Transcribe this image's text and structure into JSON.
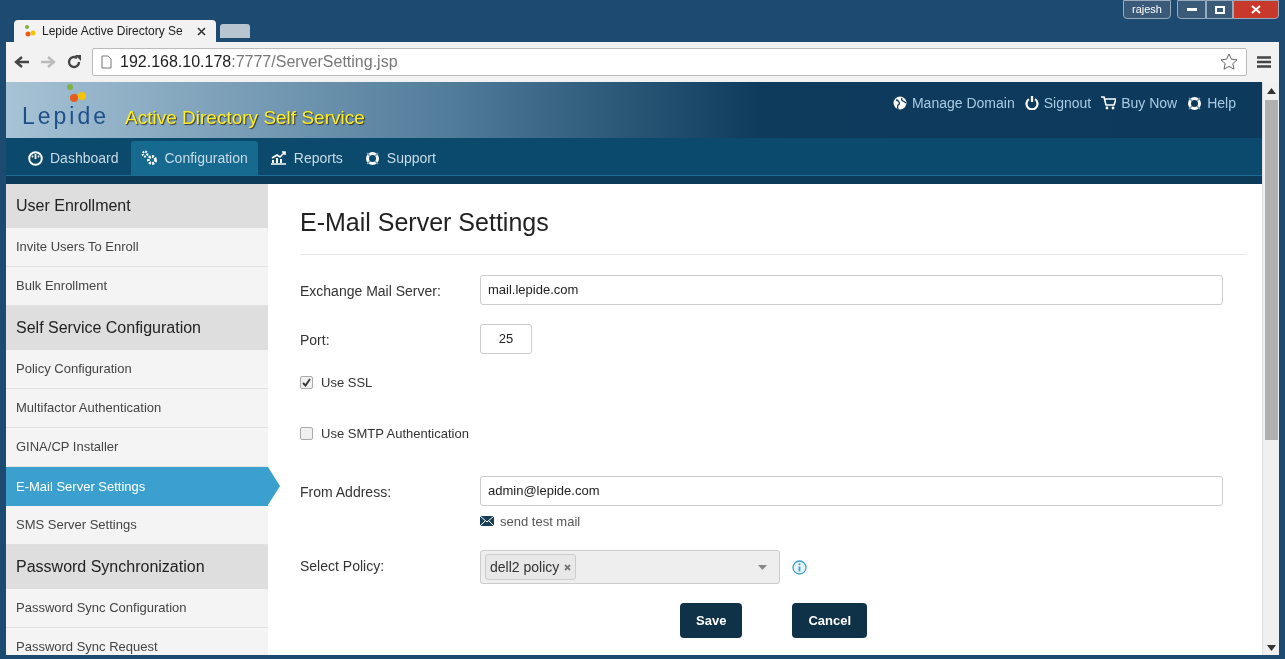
{
  "browser": {
    "tab_title": "Lepide Active Directory Se",
    "user": "rajesh",
    "url_host": "192.168.10.178",
    "url_path": ":7777/ServerSetting.jsp"
  },
  "header": {
    "logo": "Lepide",
    "product": "Active Directory Self Service",
    "links": [
      "Manage Domain",
      "Signout",
      "Buy Now",
      "Help"
    ]
  },
  "nav": [
    {
      "label": "Dashboard",
      "selected": false
    },
    {
      "label": "Configuration",
      "selected": true
    },
    {
      "label": "Reports",
      "selected": false
    },
    {
      "label": "Support",
      "selected": false
    }
  ],
  "sidebar": [
    {
      "kind": "header",
      "label": "User Enrollment"
    },
    {
      "kind": "item",
      "label": "Invite Users To Enroll",
      "selected": false
    },
    {
      "kind": "item",
      "label": "Bulk Enrollment",
      "selected": false
    },
    {
      "kind": "header",
      "label": "Self Service Configuration"
    },
    {
      "kind": "item",
      "label": "Policy Configuration",
      "selected": false
    },
    {
      "kind": "item",
      "label": "Multifactor Authentication",
      "selected": false
    },
    {
      "kind": "item",
      "label": "GINA/CP Installer",
      "selected": false
    },
    {
      "kind": "item",
      "label": "E-Mail Server Settings",
      "selected": true
    },
    {
      "kind": "item",
      "label": "SMS Server Settings",
      "selected": false
    },
    {
      "kind": "header",
      "label": "Password Synchronization"
    },
    {
      "kind": "item",
      "label": "Password Sync Configuration",
      "selected": false
    },
    {
      "kind": "item",
      "label": "Password Sync Request",
      "selected": false
    }
  ],
  "page": {
    "title": "E-Mail Server Settings",
    "fields": [
      {
        "kind": "text",
        "label": "Exchange Mail Server:",
        "value": "mail.lepide.com"
      },
      {
        "kind": "short",
        "label": "Port:",
        "value": "25"
      },
      {
        "kind": "checkbox",
        "label": "Use SSL",
        "checked": true
      },
      {
        "kind": "checkbox",
        "label": "Use SMTP Authentication",
        "checked": false
      },
      {
        "kind": "text",
        "label": "From Address:",
        "value": "admin@lepide.com",
        "link": "send test mail"
      },
      {
        "kind": "select",
        "label": "Select Policy:",
        "tags": [
          "dell2 policy"
        ]
      }
    ],
    "buttons": [
      "Save",
      "Cancel"
    ]
  }
}
